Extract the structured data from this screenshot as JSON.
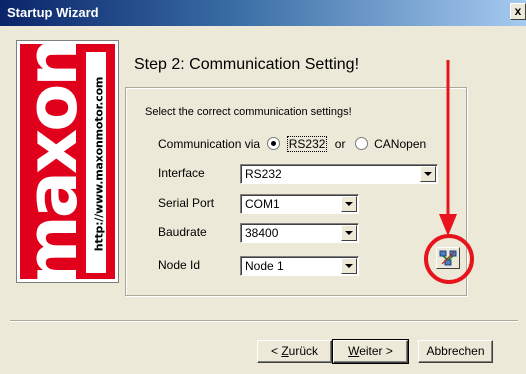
{
  "window": {
    "title": "Startup Wizard",
    "close_label": "x"
  },
  "logo": {
    "brand": "maxon",
    "url": "http://www.maxonmotor.com",
    "brand_color": "#e0001b"
  },
  "step": {
    "title": "Step 2: Communication Setting!"
  },
  "group": {
    "instruction": "Select the correct communication settings!",
    "comm_label": "Communication via",
    "rs232_label": "RS232",
    "or_label": "or",
    "canopen_label": "CANopen",
    "selected_comm": "RS232"
  },
  "fields": {
    "interface": {
      "label": "Interface",
      "value": "RS232"
    },
    "serial_port": {
      "label": "Serial Port",
      "value": "COM1"
    },
    "baudrate": {
      "label": "Baudrate",
      "value": "38400"
    },
    "node_id": {
      "label": "Node Id",
      "value": "Node 1"
    }
  },
  "buttons": {
    "back_prefix": "< ",
    "back_mnemonic": "Z",
    "back_rest": "urück",
    "next_mnemonic": "W",
    "next_rest": "eiter >",
    "cancel": "Abbrechen"
  },
  "annotation": {
    "color": "#e8141c"
  }
}
